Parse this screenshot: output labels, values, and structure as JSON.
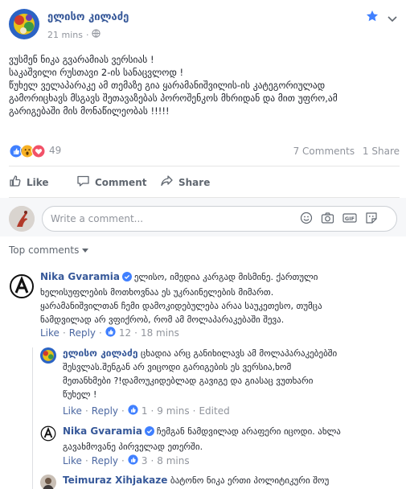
{
  "post": {
    "author": "ელისო კილაძე",
    "time": "21 mins",
    "lines": [
      "ვუსმენ ნიკა გვარამიას ვერსიას !",
      "საკაშვილი რუსთავი 2-ის სანაცვლოდ !",
      "წუხელ ველაპარაკე ამ თემაზე გია ყარამანიშვილის-ის კატეგორიულად",
      "გამორიცხავს მსგავს შეთავაზებას პოროშენკოს მხრიდან და მით უფრო,ამ",
      "გარიგებაში მის მონაწილეობას !!!!!"
    ]
  },
  "stats": {
    "reaction_count": "49",
    "comments": "7 Comments",
    "shares": "1 Share"
  },
  "actions": {
    "like": "Like",
    "comment": "Comment",
    "share": "Share"
  },
  "composer": {
    "placeholder": "Write a comment..."
  },
  "top_comments_label": "Top comments",
  "comments": [
    {
      "author": "Nika Gvaramia",
      "lines": [
        "ელისო, იმედია კარგად მისმინე. ქართული",
        "ხელისუფლების მოთხოვნაა ეს უკრაინელების მიმართ.",
        "ყარამანიშვილთან ჩემი დამოკიდებულება არაა საუკეთესო, თუმცა",
        "ნამდვილად არ ვფიქრობ, რომ ამ მოლაპარაკებაში შევა."
      ],
      "like": "Like",
      "reply": "Reply",
      "reactions": "12",
      "time": "18 mins"
    },
    {
      "author": "ელისო კილაძე",
      "lines": [
        "ცხადია არც განიხილავს ამ მოლაპარაკებებში",
        "შესვლას.შენგან არ ვიცოდი გარიგების ეს ვერსია,ხომ",
        "მეთანხმები ?!დამოუკიდებლად გავიგე და გიასაც ვუთხარი",
        "წუხელ !"
      ],
      "like": "Like",
      "reply": "Reply",
      "reactions": "1",
      "time": "9 mins",
      "edited": "Edited"
    },
    {
      "author": "Nika Gvaramia",
      "lines": [
        "ჩემგან ნამდვილად არაფერი იცოდი. ახლა",
        "გავახმოვანე პირველად ეთერში."
      ],
      "like": "Like",
      "reply": "Reply",
      "reactions": "3",
      "time": "8 mins"
    },
    {
      "author": "Teimuraz Xihjakaze",
      "lines": [
        "ბატონო ნიკა ერთი პოლიტიკური შოუ"
      ]
    }
  ],
  "colors": {
    "link_blue": "#365899",
    "like_blue": "#4b67a1",
    "meta_gray": "#90949c",
    "star_blue": "#4080ff"
  }
}
